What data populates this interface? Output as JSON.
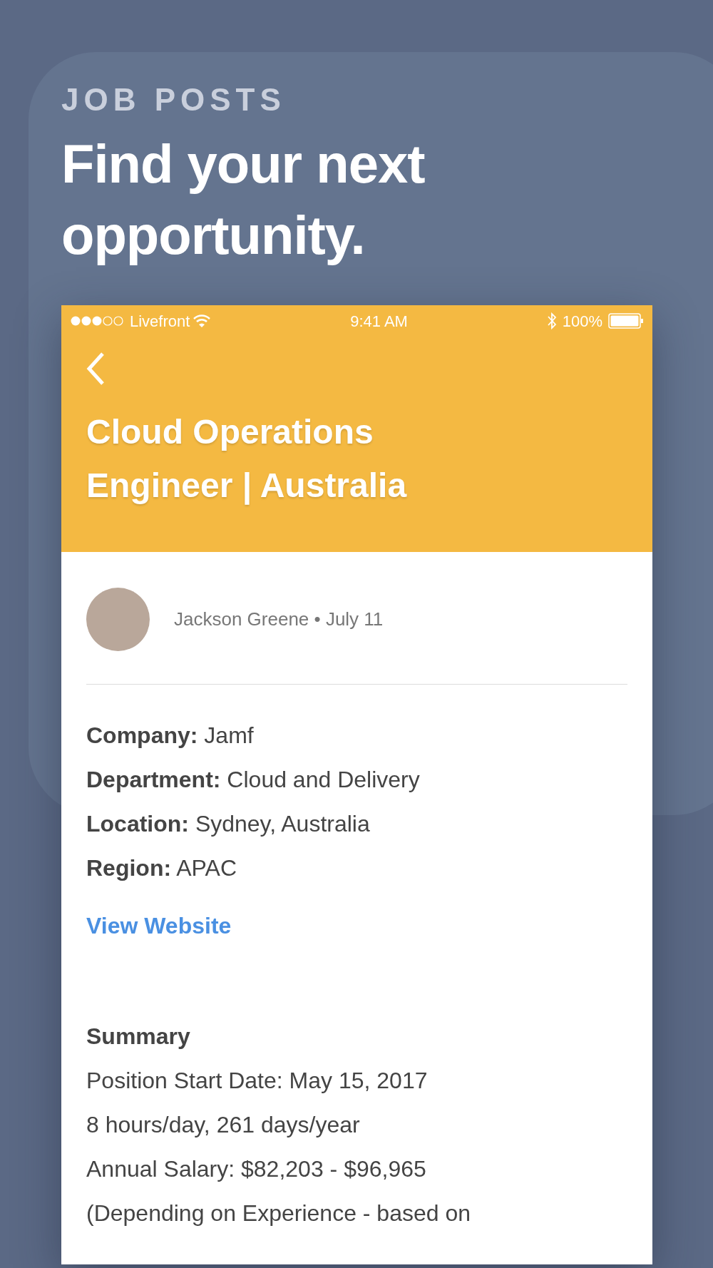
{
  "header": {
    "eyebrow": "JOB POSTS",
    "title": "Find your next opportunity."
  },
  "status_bar": {
    "carrier": "Livefront",
    "time": "9:41 AM",
    "battery": "100%"
  },
  "job": {
    "title": "Cloud Operations Engineer | Australia",
    "byline": "Jackson Greene • July 11",
    "details": [
      "**Company:** Jamf",
      "**Department:** Cloud and Delivery",
      "**Location:** Sydney, Australia",
      "**Region:** APAC"
    ],
    "link": "View Website",
    "summary": {
      "heading": "Summary",
      "lines": [
        "Position Start Date: May 15, 2017",
        "8 hours/day, 261 days/year",
        "Annual Salary: $82,203 - $96,965",
        "(Depending on Experience - based on"
      ]
    }
  }
}
